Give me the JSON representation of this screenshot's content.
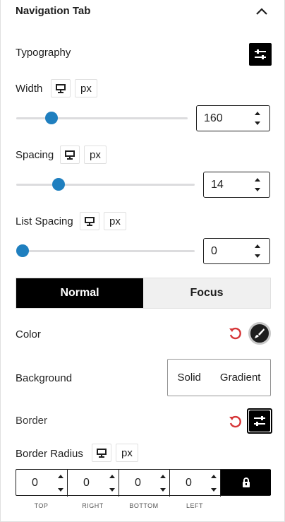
{
  "panel": {
    "title": "Navigation Tab"
  },
  "typography": {
    "label": "Typography"
  },
  "width": {
    "label": "Width",
    "unit": "px",
    "value": "160",
    "slider_fraction": 0.17
  },
  "spacing": {
    "label": "Spacing",
    "unit": "px",
    "value": "14",
    "slider_fraction": 0.2
  },
  "list_spacing": {
    "label": "List Spacing",
    "unit": "px",
    "value": "0",
    "slider_fraction": 0.0
  },
  "state_tabs": [
    {
      "label": "Normal",
      "active": true
    },
    {
      "label": "Focus",
      "active": false
    }
  ],
  "color": {
    "label": "Color"
  },
  "background": {
    "label": "Background",
    "options": [
      "Solid",
      "Gradient"
    ]
  },
  "border": {
    "label": "Border"
  },
  "border_radius": {
    "label": "Border Radius",
    "unit": "px",
    "values": [
      "0",
      "0",
      "0",
      "0"
    ],
    "labels": [
      "TOP",
      "RIGHT",
      "BOTTOM",
      "LEFT"
    ]
  },
  "colors": {
    "accent": "#1f7fbf",
    "reset": "#d63638",
    "dark": "#000000"
  },
  "icons": {
    "collapse": "chevron-up-icon",
    "typography": "sliders-icon",
    "device": "desktop-icon",
    "reset": "reset-icon",
    "color": "brush-icon",
    "border": "sliders-icon",
    "lock": "lock-icon"
  }
}
